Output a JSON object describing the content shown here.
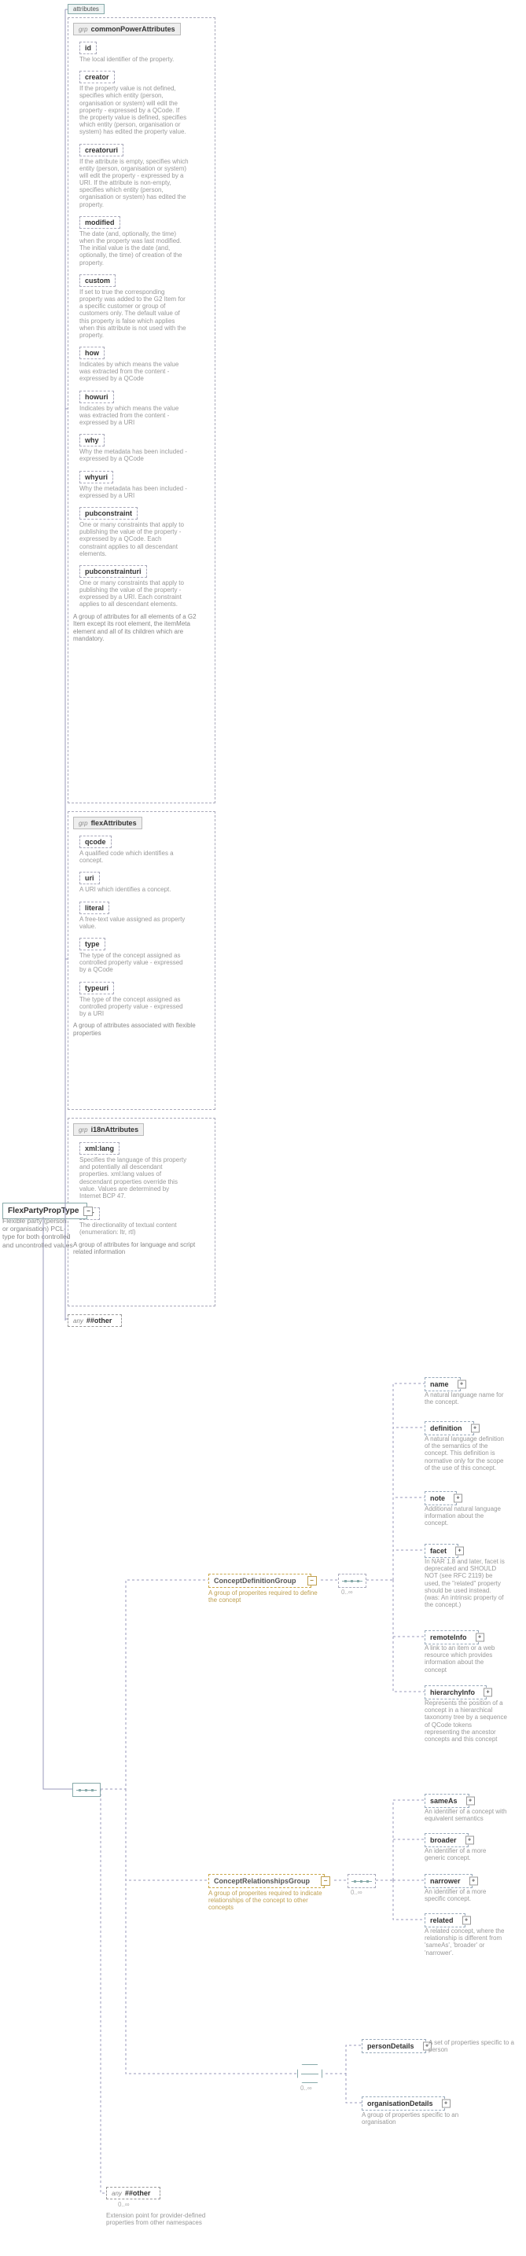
{
  "attributes_tab": "attributes",
  "root": {
    "name": "FlexPartyPropType",
    "desc": "Flexible party (person or organisation) PCL-type for both controlled and uncontrolled values"
  },
  "common": {
    "title": "commonPowerAttributes",
    "caption": "A group of attributes for all elements of a G2 Item except its root element, the itemMeta element and all of its children which are mandatory.",
    "items": [
      {
        "name": "id",
        "desc": "The local identifier of the property."
      },
      {
        "name": "creator",
        "desc": "If the property value is not defined, specifies which entity (person, organisation or system) will edit the property - expressed by a QCode. If the property value is defined, specifies which entity (person, organisation or system) has edited the property value."
      },
      {
        "name": "creatoruri",
        "desc": "If the attribute is empty, specifies which entity (person, organisation or system) will edit the property - expressed by a URI. If the attribute is non-empty, specifies which entity (person, organisation or system) has edited the property."
      },
      {
        "name": "modified",
        "desc": "The date (and, optionally, the time) when the property was last modified. The initial value is the date (and, optionally, the time) of creation of the property."
      },
      {
        "name": "custom",
        "desc": "If set to true the corresponding property was added to the G2 Item for a specific customer or group of customers only. The default value of this property is false which applies when this attribute is not used with the property."
      },
      {
        "name": "how",
        "desc": "Indicates by which means the value was extracted from the content - expressed by a QCode"
      },
      {
        "name": "howuri",
        "desc": "Indicates by which means the value was extracted from the content - expressed by a URI"
      },
      {
        "name": "why",
        "desc": "Why the metadata has been included - expressed by a QCode"
      },
      {
        "name": "whyuri",
        "desc": "Why the metadata has been included - expressed by a URI"
      },
      {
        "name": "pubconstraint",
        "desc": "One or many constraints that apply to publishing the value of the property - expressed by a QCode. Each constraint applies to all descendant elements."
      },
      {
        "name": "pubconstrainturi",
        "desc": "One or many constraints that apply to publishing the value of the property - expressed by a URI. Each constraint applies to all descendant elements."
      }
    ]
  },
  "flex": {
    "title": "flexAttributes",
    "caption": "A group of attributes associated with flexible properties",
    "items": [
      {
        "name": "qcode",
        "desc": "A qualified code which identifies a concept."
      },
      {
        "name": "uri",
        "desc": "A URI which identifies a concept."
      },
      {
        "name": "literal",
        "desc": "A free-text value assigned as property value."
      },
      {
        "name": "type",
        "desc": "The type of the concept assigned as controlled property value - expressed by a QCode"
      },
      {
        "name": "typeuri",
        "desc": "The type of the concept assigned as controlled property value - expressed by a URI"
      }
    ]
  },
  "i18n": {
    "title": "i18nAttributes",
    "caption": "A group of attributes for language and script related information",
    "items": [
      {
        "name": "xml:lang",
        "desc": "Specifies the language of this property and potentially all descendant properties. xml:lang values of descendant properties override this value. Values are determined by Internet BCP 47."
      },
      {
        "name": "dir",
        "desc": "The directionality of textual content (enumeration: ltr, rtl)"
      }
    ]
  },
  "any_other_attr": "##other",
  "seq_label": "",
  "defGroup": {
    "name": "ConceptDefinitionGroup",
    "desc": "A group of properites required to define the concept",
    "card": "0..∞",
    "children": [
      {
        "name": "name",
        "desc": "A natural language name for the concept."
      },
      {
        "name": "definition",
        "desc": "A natural language definition of the semantics of the concept. This definition is normative only for the scope of the use of this concept."
      },
      {
        "name": "note",
        "desc": "Additional natural language information about the concept."
      },
      {
        "name": "facet",
        "desc": "In NAR 1.8 and later, facet is deprecated and SHOULD NOT (see RFC 2119) be used, the \"related\" property should be used instead. (was: An intrinsic property of the concept.)"
      },
      {
        "name": "remoteInfo",
        "desc": "A link to an item or a web resource which provides information about the concept"
      },
      {
        "name": "hierarchyInfo",
        "desc": "Represents the position of a concept in a hierarchical taxonomy tree by a sequence of QCode tokens representing the ancestor concepts and this concept"
      }
    ]
  },
  "relGroup": {
    "name": "ConceptRelationshipsGroup",
    "desc": "A group of properites required to indicate relationships of the concept to other concepts",
    "card": "0..∞",
    "children": [
      {
        "name": "sameAs",
        "desc": "An identifier of a concept with equivalent semantics"
      },
      {
        "name": "broader",
        "desc": "An identifier of a more generic concept."
      },
      {
        "name": "narrower",
        "desc": "An identifier of a more specific concept."
      },
      {
        "name": "related",
        "desc": "A related concept, where the relationship is different from 'sameAs', 'broader' or 'narrower'."
      }
    ]
  },
  "choice_card": "0..∞",
  "personDetails": {
    "name": "personDetails",
    "desc": "A set of properties specific to a person"
  },
  "orgDetails": {
    "name": "organisationDetails",
    "desc": "A group of properties specific to an organisation"
  },
  "any_other_el": {
    "label": "##other",
    "card": "0..∞",
    "desc": "Extension point for provider-defined properties from other namespaces"
  },
  "any_lab": "any",
  "grp_lab": "grp"
}
